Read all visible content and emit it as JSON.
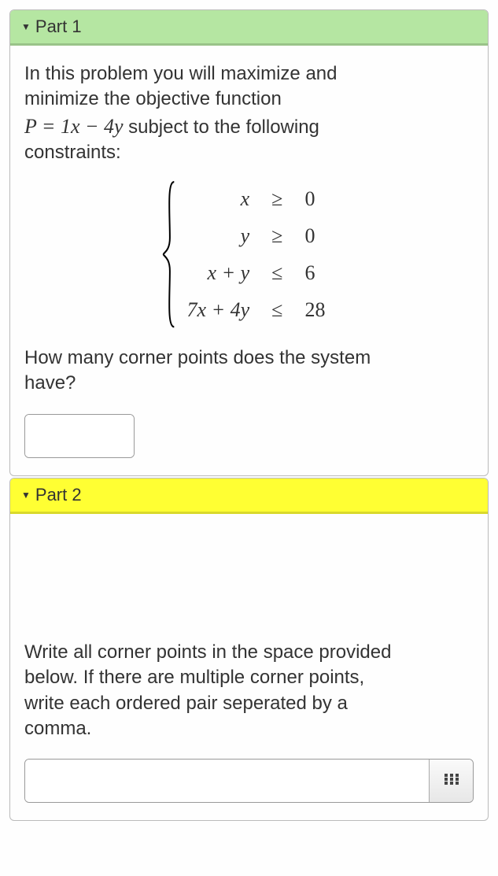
{
  "part1": {
    "title": "Part 1",
    "intro_line1": "In this problem you will maximize and",
    "intro_line2": "minimize the objective function",
    "obj_prefix": "P = 1x − 4y",
    "obj_suffix": "  subject to the following",
    "intro_line4": "constraints:",
    "constraints": [
      {
        "lhs": "x",
        "op": "≥",
        "rhs": "0"
      },
      {
        "lhs": "y",
        "op": "≥",
        "rhs": "0"
      },
      {
        "lhs": "x + y",
        "op": "≤",
        "rhs": "6"
      },
      {
        "lhs": "7x + 4y",
        "op": "≤",
        "rhs": "28"
      }
    ],
    "question_line1": "How many corner points does the system",
    "question_line2": "have?",
    "answer_value": ""
  },
  "part2": {
    "title": "Part 2",
    "prompt_line1": "Write all corner points in the space provided",
    "prompt_line2": "below. If there are multiple corner points,",
    "prompt_line3": "write each ordered pair seperated by a",
    "prompt_line4": "comma.",
    "answer_value": ""
  },
  "icons": {
    "keypad": "⋮⋮⋮"
  }
}
